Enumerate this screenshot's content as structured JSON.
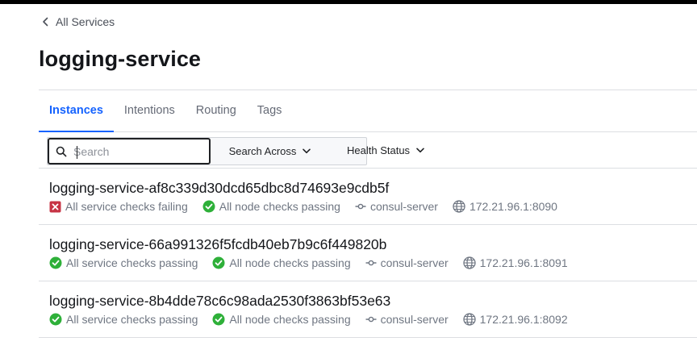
{
  "nav": {
    "back_label": "All Services"
  },
  "page": {
    "title": "logging-service"
  },
  "tabs": [
    {
      "label": "Instances",
      "active": true
    },
    {
      "label": "Intentions",
      "active": false
    },
    {
      "label": "Routing",
      "active": false
    },
    {
      "label": "Tags",
      "active": false
    }
  ],
  "filters": {
    "search_placeholder": "Search",
    "search_value": "",
    "search_across_label": "Search Across",
    "health_status_label": "Health Status"
  },
  "colors": {
    "accent": "#1563ff",
    "passing": "#2eb039",
    "failing": "#c73445",
    "muted_text": "#6f7682"
  },
  "instances": [
    {
      "name": "logging-service-af8c339d30dcd65dbc8d74693e9cdb5f",
      "service_checks": "All service checks failing",
      "service_status": "failing",
      "node_checks": "All node checks passing",
      "node_status": "passing",
      "node": "consul-server",
      "address": "172.21.96.1:8090"
    },
    {
      "name": "logging-service-66a991326f5fcdb40eb7b9c6f449820b",
      "service_checks": "All service checks passing",
      "service_status": "passing",
      "node_checks": "All node checks passing",
      "node_status": "passing",
      "node": "consul-server",
      "address": "172.21.96.1:8091"
    },
    {
      "name": "logging-service-8b4dde78c6c98ada2530f3863bf53e63",
      "service_checks": "All service checks passing",
      "service_status": "passing",
      "node_checks": "All node checks passing",
      "node_status": "passing",
      "node": "consul-server",
      "address": "172.21.96.1:8092"
    }
  ],
  "icons": {
    "back": "chevron-left-icon",
    "search": "search-icon",
    "dropdown": "chevron-down-icon",
    "check_pass": "check-circle-icon",
    "check_fail": "x-square-icon",
    "node": "git-commit-icon",
    "address": "globe-icon"
  }
}
